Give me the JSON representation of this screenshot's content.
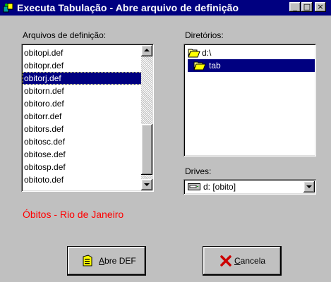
{
  "window": {
    "title": "Executa Tabulação - Abre arquivo de definição",
    "icon": "app-icon",
    "controls": [
      {
        "name": "minimize-button",
        "glyph": "_"
      },
      {
        "name": "maximize-button",
        "glyph": "□"
      },
      {
        "name": "close-button",
        "glyph": "×"
      }
    ]
  },
  "files": {
    "label": "Arquivos de definição:",
    "items": [
      "obitopi.def",
      "obitopr.def",
      "obitorj.def",
      "obitorn.def",
      "obitoro.def",
      "obitorr.def",
      "obitors.def",
      "obitosc.def",
      "obitose.def",
      "obitosp.def",
      "obitoto.def"
    ],
    "selected": "obitorj.def"
  },
  "directories": {
    "label": "Diretórios:",
    "items": [
      {
        "label": "d:\\",
        "icon": "open-folder-icon"
      },
      {
        "label": "tab",
        "icon": "open-folder-icon",
        "selected": true
      }
    ]
  },
  "drives": {
    "label": "Drives:",
    "selected": "d: [obito]",
    "icon": "drive-icon"
  },
  "status": {
    "text": "Óbitos - Rio de Janeiro",
    "color": "#ff0000"
  },
  "buttons": {
    "open_label": "Abre DEF",
    "cancel_label": "Cancela"
  },
  "colors": {
    "titlebar": "#000080",
    "face": "#c0c0c0",
    "selection": "#000080"
  }
}
